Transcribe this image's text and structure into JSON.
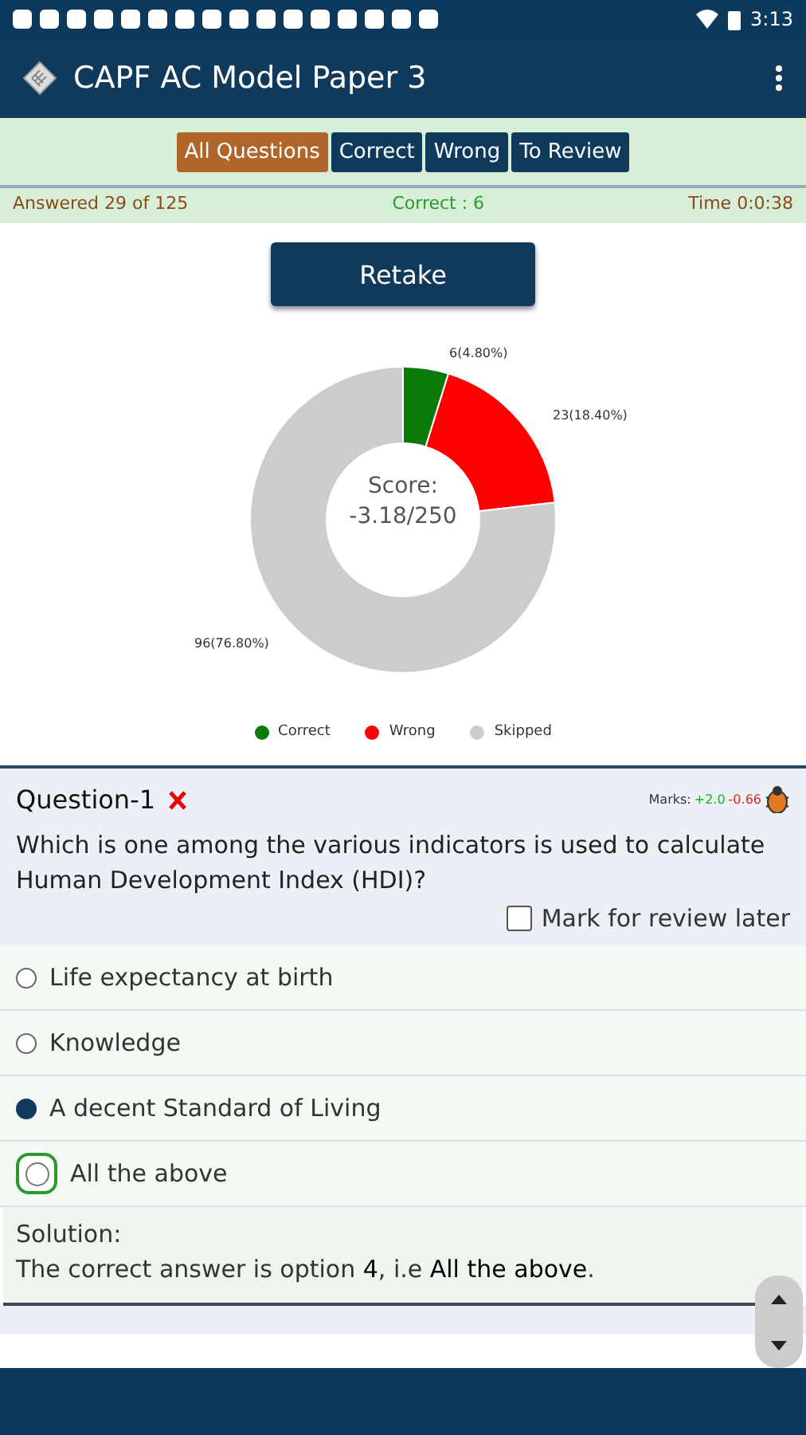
{
  "status_bar": {
    "time": "3:13"
  },
  "app_bar": {
    "title": "CAPF AC Model Paper 3"
  },
  "tabs": [
    {
      "label": "All Questions",
      "selected": true
    },
    {
      "label": "Correct",
      "selected": false
    },
    {
      "label": "Wrong",
      "selected": false
    },
    {
      "label": "To Review",
      "selected": false
    }
  ],
  "summary": {
    "answered": "Answered 29 of 125",
    "correct": "Correct : 6",
    "time": "Time 0:0:38"
  },
  "retake_button": "Retake",
  "chart": {
    "center_label": "Score:",
    "center_value": "-3.18/250",
    "chart_data": {
      "type": "donut",
      "categories": [
        "Correct",
        "Wrong",
        "Skipped"
      ],
      "series": [
        {
          "values": [
            4.8,
            18.4,
            76.8
          ]
        }
      ],
      "value_labels": [
        "6(4.80%)",
        "23(18.40%)",
        "96(76.80%)"
      ]
    },
    "legend": [
      {
        "color": "#0a7a0a"
      },
      {
        "color": "#ff0000"
      },
      {
        "color": "#cccccc"
      }
    ]
  },
  "question": {
    "title": "Question-1",
    "wrong": true,
    "marks_label": "Marks:",
    "marks_plus": "+2.0",
    "marks_minus": "-0.66",
    "text": "Which is one among the various indicators is used to calculate Human Development Index (HDI)?",
    "review": {
      "label": "Mark for review later",
      "checked": false
    },
    "options": [
      {
        "label": "Life expectancy at birth",
        "selected": false,
        "correct": false
      },
      {
        "label": "Knowledge",
        "selected": false,
        "correct": false
      },
      {
        "label": "A decent Standard of Living",
        "selected": true,
        "correct": false
      },
      {
        "label": "All the above",
        "selected": false,
        "correct": true
      }
    ],
    "solution_label": "Solution:",
    "solution": "The correct answer is option **4**, i.e **All the above**."
  }
}
